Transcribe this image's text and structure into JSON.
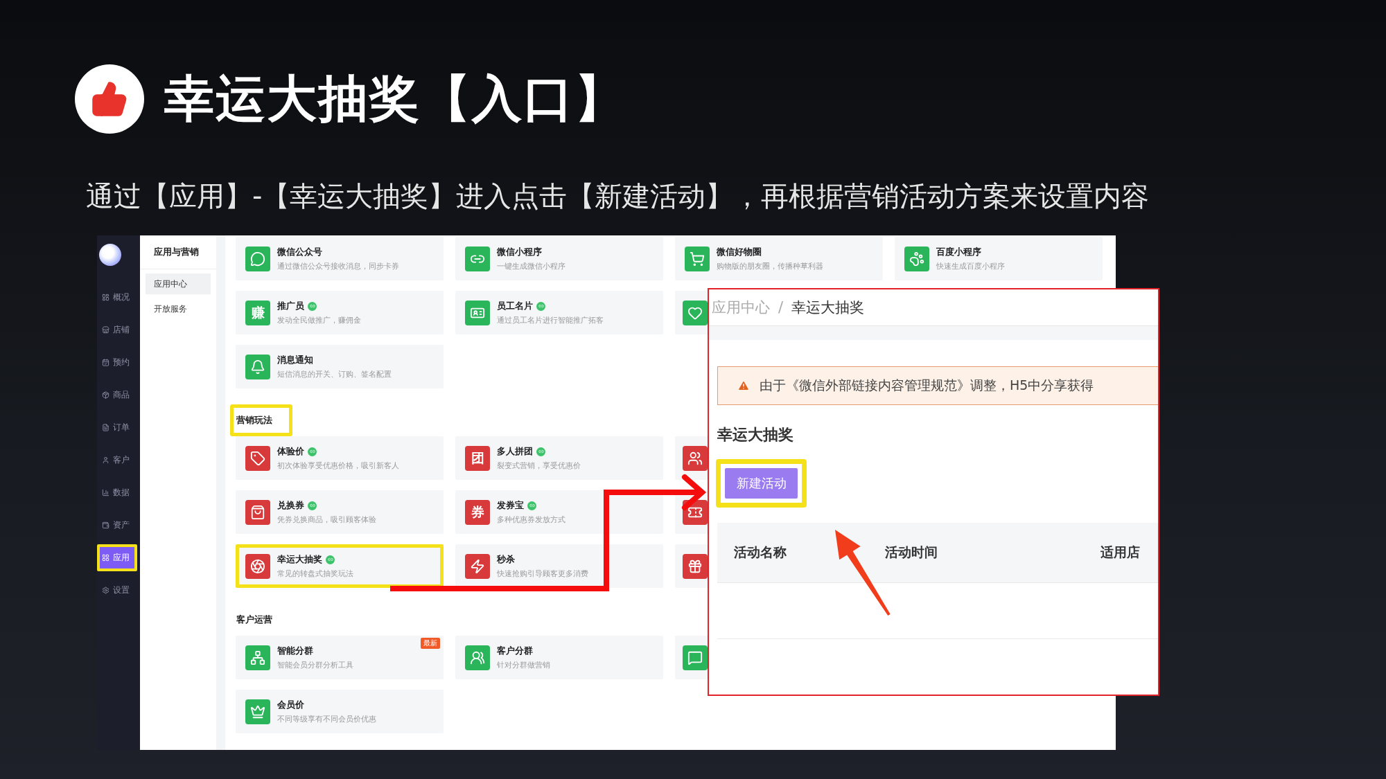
{
  "slide": {
    "title": "幸运大抽奖【入口】",
    "subtitle": "通过【应用】-【幸运大抽奖】进入点击【新建活动】，再根据营销活动方案来设置内容"
  },
  "sidebar": {
    "items": [
      {
        "label": "概况",
        "selected": false,
        "highlighted": false
      },
      {
        "label": "店铺",
        "selected": false,
        "highlighted": false
      },
      {
        "label": "预约",
        "selected": false,
        "highlighted": false
      },
      {
        "label": "商品",
        "selected": false,
        "highlighted": false
      },
      {
        "label": "订单",
        "selected": false,
        "highlighted": false
      },
      {
        "label": "客户",
        "selected": false,
        "highlighted": false
      },
      {
        "label": "数据",
        "selected": false,
        "highlighted": false
      },
      {
        "label": "资产",
        "selected": false,
        "highlighted": false
      },
      {
        "label": "应用",
        "selected": true,
        "highlighted": true
      },
      {
        "label": "设置",
        "selected": false,
        "highlighted": false
      }
    ]
  },
  "subnav": {
    "title": "应用与营销",
    "items": [
      {
        "label": "应用中心",
        "selected": true
      },
      {
        "label": "开放服务",
        "selected": false
      }
    ]
  },
  "sections": [
    {
      "rows": [
        [
          {
            "kind": "app",
            "title": "微信公众号",
            "description": "通过微信公众号接收消息，同步卡券",
            "verified": false,
            "color": "#2bb55a",
            "highlighted": false
          },
          {
            "kind": "app",
            "title": "微信小程序",
            "description": "一键生成微信小程序",
            "verified": false,
            "color": "#2bb55a",
            "highlighted": false
          },
          {
            "kind": "app",
            "title": "微信好物圈",
            "description": "购物版的朋友圈，传播种草利器",
            "verified": false,
            "color": "#2bb55a",
            "highlighted": false
          },
          {
            "kind": "app",
            "title": "百度小程序",
            "description": "快速生成百度小程序",
            "verified": false,
            "color": "#2bb55a",
            "highlighted": false
          }
        ],
        [
          {
            "kind": "app",
            "title": "推广员",
            "description": "发动全民做推广，赚佣金",
            "verified": true,
            "color": "#2bb55a",
            "icon_text": "赚",
            "highlighted": false
          },
          {
            "kind": "app",
            "title": "员工名片",
            "description": "通过员工名片进行智能推广拓客",
            "verified": true,
            "color": "#2bb55a",
            "highlighted": false
          },
          {
            "kind": "icon_only",
            "color": "#2bb55a"
          }
        ],
        [
          {
            "kind": "app",
            "title": "消息通知",
            "description": "短信消息的开关、订购、签名配置",
            "verified": false,
            "color": "#2bb55a",
            "highlighted": false
          }
        ]
      ]
    },
    {
      "title": "营销玩法",
      "highlighted": true,
      "rows": [
        [
          {
            "kind": "app",
            "title": "体验价",
            "description": "初次体验享受优惠价格，吸引新客人",
            "verified": true,
            "color": "#d8393b",
            "highlighted": false
          },
          {
            "kind": "app",
            "title": "多人拼团",
            "description": "裂变式营销，享受优惠价",
            "verified": true,
            "color": "#d8393b",
            "icon_text": "团",
            "highlighted": false
          },
          {
            "kind": "icon_only",
            "color": "#d8393b"
          }
        ],
        [
          {
            "kind": "app",
            "title": "兑换券",
            "description": "凭券兑换商品，吸引顾客体验",
            "verified": true,
            "color": "#d8393b",
            "highlighted": false
          },
          {
            "kind": "app",
            "title": "发券宝",
            "description": "多种优惠券发放方式",
            "verified": true,
            "color": "#d8393b",
            "icon_text": "券",
            "highlighted": false
          },
          {
            "kind": "icon_only",
            "color": "#d8393b"
          }
        ],
        [
          {
            "kind": "app",
            "title": "幸运大抽奖",
            "description": "常见的转盘式抽奖玩法",
            "verified": true,
            "color": "#d8393b",
            "highlighted": true
          },
          {
            "kind": "app",
            "title": "秒杀",
            "description": "快速抢购引导顾客更多消费",
            "verified": false,
            "color": "#d8393b",
            "highlighted": false
          },
          {
            "kind": "icon_only",
            "color": "#d8393b"
          }
        ]
      ]
    },
    {
      "title": "客户运营",
      "highlighted": false,
      "rows": [
        [
          {
            "kind": "app",
            "title": "智能分群",
            "description": "智能会员分群分析工具",
            "verified": false,
            "color": "#2bb55a",
            "badge": "最新",
            "highlighted": false
          },
          {
            "kind": "app",
            "title": "客户分群",
            "description": "针对分群做营销",
            "verified": false,
            "color": "#2bb55a",
            "highlighted": false
          },
          {
            "kind": "icon_only",
            "color": "#2bb55a"
          }
        ],
        [
          {
            "kind": "app",
            "title": "会员价",
            "description": "不同等级享有不同会员价优惠",
            "verified": false,
            "color": "#2bb55a",
            "highlighted": false
          }
        ]
      ]
    }
  ],
  "popup": {
    "breadcrumb": [
      "应用中心",
      "幸运大抽奖"
    ],
    "breadcrumb_separator": "/",
    "alert": "由于《微信外部链接内容管理规范》调整，H5中分享获得",
    "heading": "幸运大抽奖",
    "button": {
      "label": "新建活动",
      "highlighted": true
    },
    "columns": [
      "活动名称",
      "活动时间",
      "适用店"
    ]
  }
}
